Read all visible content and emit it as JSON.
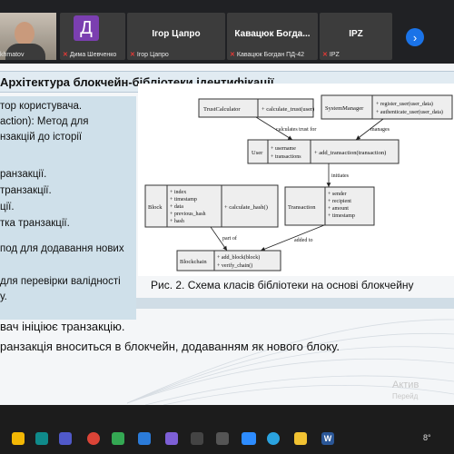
{
  "participants": {
    "self": {
      "name_fragment": "khmatov"
    },
    "tiles": [
      {
        "initial": "Д",
        "footer": "Дима Шевченко",
        "avatar_color": "#7b3fb0"
      },
      {
        "name": "Ігор Цапро",
        "footer": "Ігор Цапро"
      },
      {
        "name": "Кавацюк Богда...",
        "footer": "Кавацюк Богдан ПД-42"
      },
      {
        "name": "IPZ",
        "footer": "IPZ"
      }
    ],
    "next_icon": "chevron-right-icon",
    "muted_icon": "mic-off-icon"
  },
  "slide": {
    "title": "Архітектура блокчейн-бібліотеки ідентифікації",
    "left_lines": [
      "тор користувача.",
      "action): Метод для",
      "нзакцій до історії",
      "",
      "ранзакції.",
      "транзакції.",
      "ції.",
      "тка транзакції.",
      "",
      "под для додавання нових",
      "",
      "для перевірки валідності",
      "у."
    ],
    "caption": "Рис. 2. Схема класів бібліотеки на основі блокчейну",
    "bottom_lines": [
      "вач ініціює транзакцію.",
      "ранзакція вноситься в блокчейн, додаванням як нового блоку."
    ],
    "watermark": [
      "Актив",
      "Перейд"
    ]
  },
  "diagram": {
    "trust_calculator": {
      "name": "TrustCalculator",
      "methods": [
        "+ calculate_trust(user)"
      ]
    },
    "system_manager": {
      "name": "SystemManager",
      "methods": [
        "+ register_user(user_data)",
        "+ authenticate_user(user_data)"
      ]
    },
    "user": {
      "name": "User",
      "attrs": [
        "+ username",
        "+ transactions"
      ],
      "methods": [
        "+ add_transaction(transaction)"
      ]
    },
    "block": {
      "name": "Block",
      "attrs": [
        "+ index",
        "+ timestamp",
        "+ data",
        "+ previous_hash",
        "+ hash"
      ],
      "methods": [
        "+ calculate_hash()"
      ]
    },
    "transaction": {
      "name": "Transaction",
      "attrs": [
        "+ sender",
        "+ recipient",
        "+ amount",
        "+ timestamp"
      ]
    },
    "blockchain": {
      "name": "Blockchain",
      "methods": [
        "+ add_block(block)",
        "+ verify_chain()"
      ]
    },
    "edges": {
      "calc": "calculates trust for",
      "manages": "manages",
      "initiates": "initiates",
      "part_of": "part of",
      "added_to": "added to"
    }
  },
  "taskbar": {
    "apps": [
      {
        "icon": "files-icon",
        "color": "#f2b705"
      },
      {
        "icon": "edge-icon",
        "color": "#0f8a8a"
      },
      {
        "icon": "teams-icon",
        "color": "#5059c9"
      },
      {
        "icon": "chrome-icon",
        "color": "#db4437"
      },
      {
        "icon": "maps-icon",
        "color": "#34a853"
      },
      {
        "icon": "code-icon",
        "color": "#2b7bd9"
      },
      {
        "icon": "media-icon",
        "color": "#7d5fd6"
      },
      {
        "icon": "zoom-icon",
        "color": "#2d8cff"
      },
      {
        "icon": "telegram-icon",
        "color": "#2aa3e0"
      },
      {
        "icon": "folder-icon",
        "color": "#f1c232"
      },
      {
        "icon": "store-icon",
        "color": "#4285f4"
      },
      {
        "icon": "word-icon",
        "color": "#2b5797"
      }
    ],
    "tray_text": "8°"
  }
}
